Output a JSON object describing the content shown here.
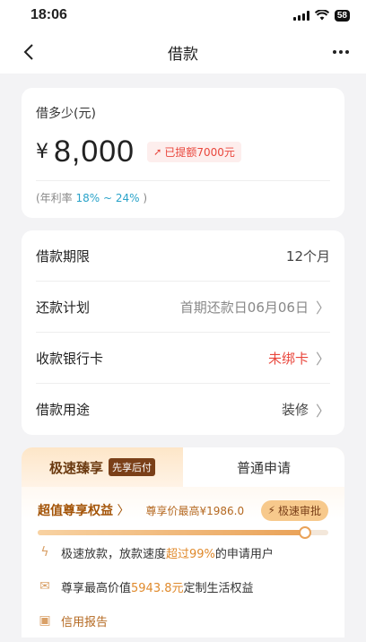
{
  "status_bar": {
    "time": "18:06",
    "battery": "58"
  },
  "nav": {
    "title": "借款",
    "back_icon": "chevron-left-icon",
    "more_icon": "more-icon"
  },
  "amount": {
    "label": "借多少(元)",
    "currency": "¥",
    "value": "8,000",
    "limit_badge": "已提额7000元",
    "rate_prefix": "(年利率 ",
    "rate_value": "18% ~ 24%",
    "rate_suffix": " )"
  },
  "details": [
    {
      "label": "借款期限",
      "value": "12个月",
      "has_chevron": false
    },
    {
      "label": "还款计划",
      "value": "首期还款日06月06日",
      "has_chevron": true
    },
    {
      "label": "收款银行卡",
      "value": "未绑卡",
      "has_chevron": true
    },
    {
      "label": "借款用途",
      "value": "装修",
      "has_chevron": true
    }
  ],
  "fast": {
    "tab_fast": "极速臻享",
    "tab_fast_badge": "先享后付",
    "tab_normal": "普通申请",
    "benefit_title": "超值尊享权益",
    "benefit_price": "尊享价最高¥1986.0",
    "fast_review": "极速审批",
    "progress": 0.92,
    "features": [
      {
        "icon": "lightning-icon",
        "pre": "极速放款，放款速度",
        "hl": "超过99%",
        "post": "的申请用户"
      },
      {
        "icon": "envelope-icon",
        "pre": "尊享最高价值",
        "hl": "5943.8元",
        "post": "定制生活权益"
      },
      {
        "icon": "report-icon",
        "pre": "信用报告",
        "hl": "",
        "post": ""
      }
    ]
  },
  "colors": {
    "accent_red": "#e9473d",
    "accent_gold": "#a35408",
    "rate_blue": "#2aa3c9"
  }
}
